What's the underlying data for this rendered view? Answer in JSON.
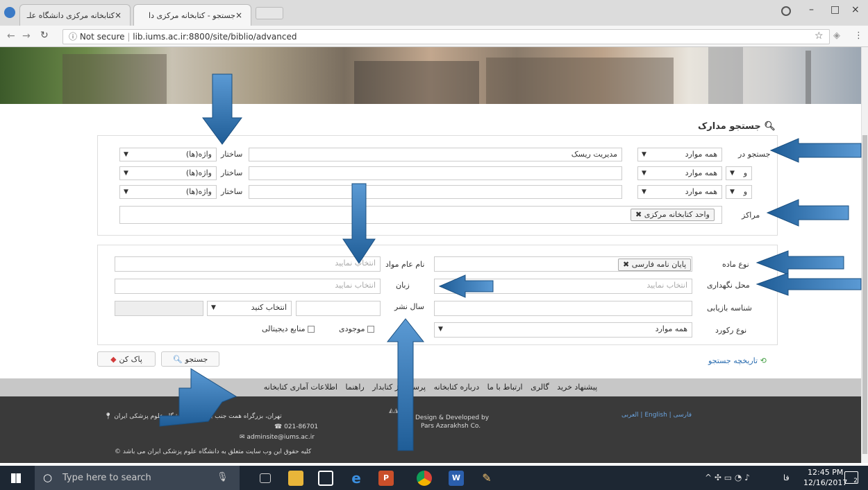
{
  "browser": {
    "tabs": [
      {
        "title": "کتابخانه مرکزی دانشگاه علـ",
        "close": "×"
      },
      {
        "title": "جستجو - کتابخانه مرکزی دا",
        "close": "×"
      }
    ],
    "url_prefix": "Not secure",
    "url": "lib.iums.ac.ir:8800/site/biblio/advanced",
    "controls": {
      "minimize": "–",
      "maximize": "□",
      "close": "×"
    }
  },
  "page": {
    "heading": "جستجو مدارک",
    "search_rows": [
      {
        "operator": "",
        "field": "همه موارد",
        "term": "مدیریت ریسک",
        "structure_label": "ساختار",
        "structure": "واژه(ها)"
      },
      {
        "operator": "و",
        "field": "همه موارد",
        "term": "",
        "structure_label": "ساختار",
        "structure": "واژه(ها)"
      },
      {
        "operator": "و",
        "field": "همه موارد",
        "term": "",
        "structure_label": "ساختار",
        "structure": "واژه(ها)"
      }
    ],
    "search_in_label": "جستجو در",
    "centers_label": "مراکز",
    "centers_chip": "واحد کتابخانه مرکزی",
    "material_type_label": "نوع ماده",
    "material_chip": "پایان نامه فارسی",
    "general_name_label": "نام عام مواد",
    "select_placeholder": "انتخاب نمایید",
    "location_label": "محل نگهداری",
    "language_label": "زبان",
    "retrieval_label": "شناسه بازیابی",
    "pub_year_label": "سال نشر",
    "pub_year_select": "انتخاب کنید",
    "record_type_label": "نوع رکورد",
    "record_type_value": "همه موارد",
    "availability_label": "موجودی",
    "digital_label": "منابع دیجیتالی",
    "history_link": "تاریخچه جستجو",
    "search_button": "جستجو",
    "clear_button": "پاک کن"
  },
  "menu": [
    "پیشنهاد خرید",
    "گالری",
    "ارتباط با ما",
    "درباره کتابخانه",
    "پرسش از کتابدار",
    "راهنما",
    "اطلاعات آماری کتابخانه"
  ],
  "footer": {
    "address": "تهران، بزرگراه همت جنب برج میلاد، دانشگاه علوم پزشکی ایران",
    "phone": "021-86701",
    "email": "adminsite@iums.ac.ir",
    "copyright": "کلیه حقوق این وب سایت متعلق به دانشگاه علوم پزشکی ایران می باشد",
    "design1": "Design & Developed by",
    "design2": "Pars Azarakhsh Co.",
    "languages": "فارسی | English | العربی"
  },
  "taskbar": {
    "search_placeholder": "Type here to search",
    "time": "12:45 PM",
    "date": "12/16/2017",
    "lang": "فا",
    "notif": "2"
  },
  "colors": {
    "arrow": "#2a6fa8",
    "footer": "#3a3a3a",
    "menu": "#c7c7c7",
    "taskbar": "#1d2733"
  }
}
